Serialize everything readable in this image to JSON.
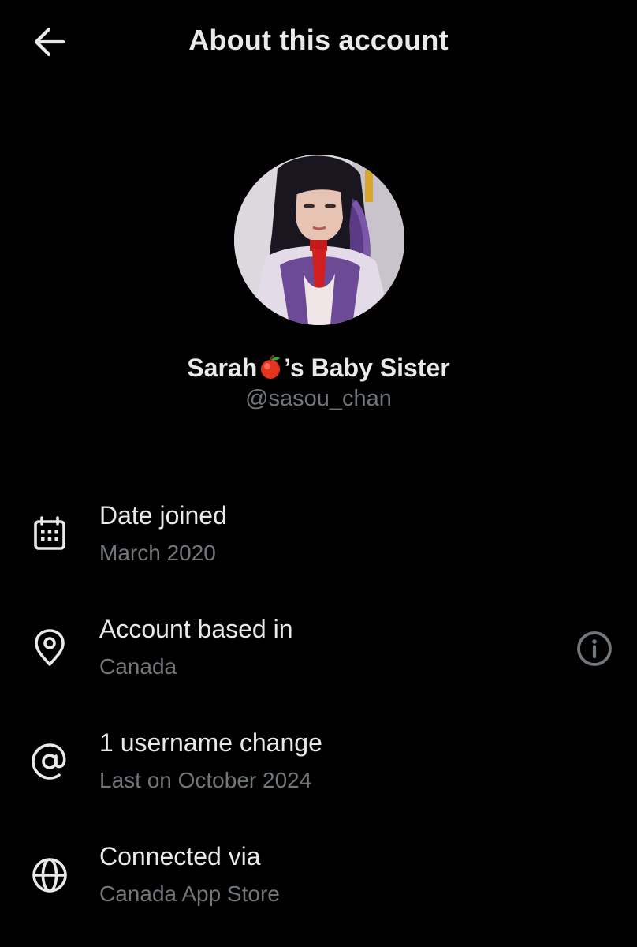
{
  "header": {
    "title": "About this account",
    "back_icon": "arrow-left-icon"
  },
  "profile": {
    "name_before_emoji": "Sarah",
    "emoji": "🍎",
    "name_after_emoji": "’s Baby Sister",
    "handle": "@sasou_chan"
  },
  "details": {
    "date_joined": {
      "icon": "calendar-icon",
      "title": "Date joined",
      "value": "March 2020"
    },
    "based_in": {
      "icon": "location-pin-icon",
      "title": "Account based in",
      "value": "Canada",
      "action_icon": "info-icon"
    },
    "username_changes": {
      "icon": "at-sign-icon",
      "title": "1 username change",
      "value": "Last on October 2024"
    },
    "connected_via": {
      "icon": "globe-icon",
      "title": "Connected via",
      "value": "Canada App Store"
    }
  },
  "colors": {
    "background": "#000000",
    "primary_text": "#e7e9ea",
    "secondary_text": "#71767b"
  }
}
